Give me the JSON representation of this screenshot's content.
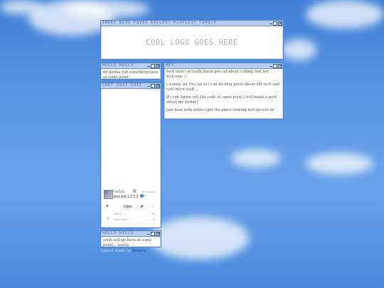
{
  "nav": {
    "title": "INDEX BLOG FAVES GALLERY PLAYLIST TUMBLR"
  },
  "logo": {
    "text": "COOL LOGO GOES HERE"
  },
  "hello_top": {
    "title": "HELLO HELLO",
    "text": "im gonna put something here at some point"
  },
  "blog": {
    "title": "HEY",
    "paragraphs": [
      "fuck man i actually know piss all about coding. but hey welcome :)",
      "i wanna set this up so i can do blog posts about old tech and cool retro stuff ...",
      "if i can figure out the code at some point i will make a post about my koriar?",
      "just beat with white i get the place looking half decent lol"
    ]
  },
  "cbox": {
    "title": "CHAT CHAT CHIT",
    "message": {
      "user": "nathan",
      "time": "36 minutes ago",
      "text": "test test 1 2 1 2"
    },
    "controls": {
      "button": "Cbox",
      "name_placeholder": "name",
      "message_placeholder": "message",
      "count": "40",
      "counter2": "0"
    }
  },
  "hello_bottom": {
    "title": "HELLO HELLO",
    "text": "smth will go here at some point... surely."
  },
  "footer": {
    "prefix": "Layout made by",
    "link": "Bizarre"
  }
}
